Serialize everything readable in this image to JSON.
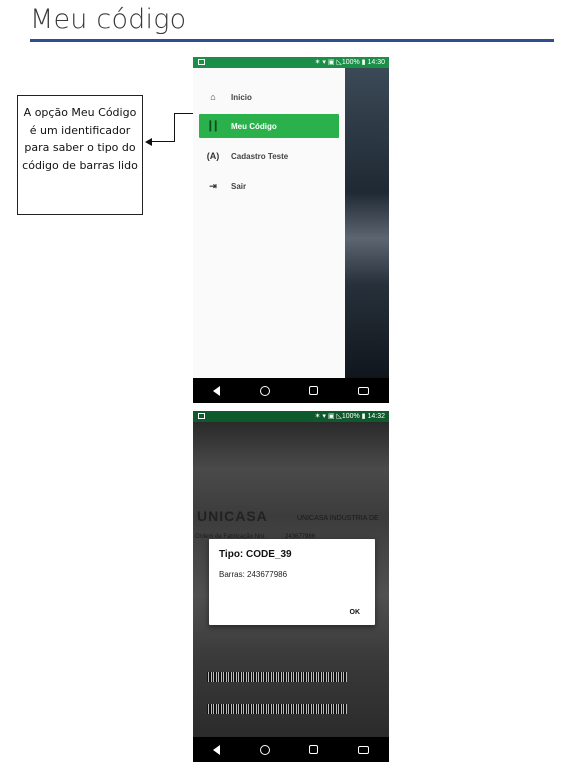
{
  "page": {
    "title": "Meu código",
    "callout": "A opção Meu Código é um identificador para saber o tipo do código de barras lido"
  },
  "phone1": {
    "status": "✶ ▾ ▣ ◺100% ▮ 14:30",
    "menu": [
      {
        "icon": "home-icon",
        "glyph": "⌂",
        "label": "Inicio"
      },
      {
        "icon": "barcode-icon",
        "glyph": "┃┃",
        "label": "Meu Código"
      },
      {
        "icon": "register-icon",
        "glyph": "(A)",
        "label": "Cadastro Teste"
      },
      {
        "icon": "logout-icon",
        "glyph": "⇥",
        "label": "Sair"
      }
    ]
  },
  "phone2": {
    "status": "✶ ▾ ▣ ◺100% ▮ 14:32",
    "dialog": {
      "title": "Tipo: CODE_39",
      "body": "Barras: 243677986",
      "ok": "OK"
    },
    "background_text": {
      "brand": "UNICASA",
      "company": "UNICASA INDUSTRIA DE",
      "order_label": "Ordem de Fabricação Nro.",
      "order_number": "243677986"
    }
  },
  "colors": {
    "accent": "#2bb14c",
    "statusbar": "#1b8f48",
    "rule": "#2f4d8f"
  }
}
